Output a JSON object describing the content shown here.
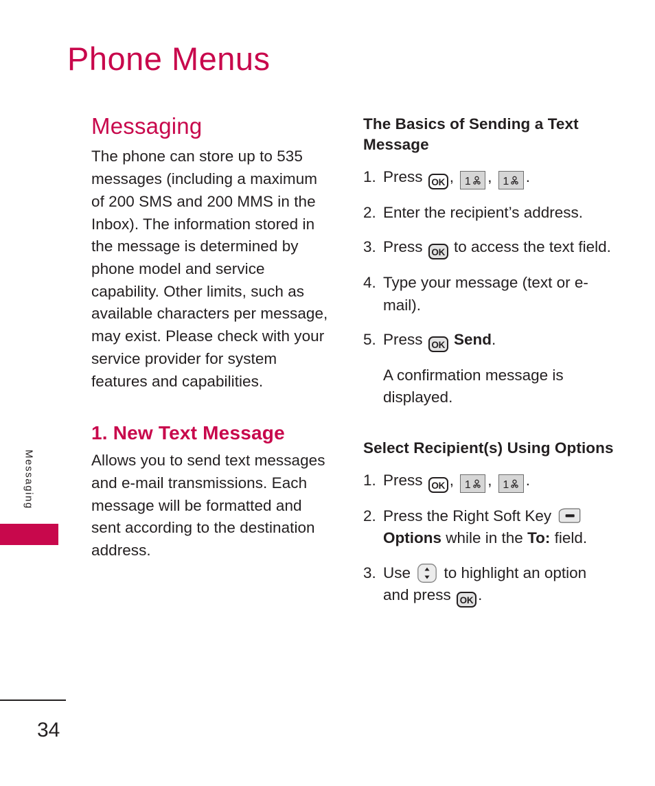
{
  "page": {
    "title": "Phone Menus",
    "number": "34",
    "side_tab_label": "Messaging",
    "accent_color": "#c8084c",
    "text_color": "#231f20"
  },
  "left_column": {
    "heading": "Messaging",
    "intro_paragraph": "The phone can store up to 535 messages (including a maximum of 200 SMS and 200 MMS in the Inbox). The information stored in the message is determined by phone model and service capability. Other limits, such as available characters per message, may exist. Please check with your service provider for system features and capabilities.",
    "subsection_heading": "1. New Text Message",
    "subsection_paragraph": "Allows you to send text messages and e-mail transmissions. Each message will be formatted and sent according to the destination address."
  },
  "right_column": {
    "basics": {
      "heading": "The Basics of Sending a Text Message",
      "steps": [
        {
          "num": "1.",
          "parts": [
            {
              "type": "text",
              "value": "Press "
            },
            {
              "type": "key",
              "icon": "ok-key-icon",
              "label": "OK",
              "style": "outline"
            },
            {
              "type": "text",
              "value": ", "
            },
            {
              "type": "key",
              "icon": "number-one-key-icon",
              "label": "1",
              "style": "numeric"
            },
            {
              "type": "text",
              "value": ", "
            },
            {
              "type": "key",
              "icon": "number-one-key-icon",
              "label": "1",
              "style": "numeric"
            },
            {
              "type": "text",
              "value": "."
            }
          ]
        },
        {
          "num": "2.",
          "parts": [
            {
              "type": "text",
              "value": "Enter the recipient’s address."
            }
          ]
        },
        {
          "num": "3.",
          "parts": [
            {
              "type": "text",
              "value": "Press "
            },
            {
              "type": "key",
              "icon": "ok-key-icon",
              "label": "OK",
              "style": "filled"
            },
            {
              "type": "text",
              "value": " to access the text field."
            }
          ]
        },
        {
          "num": "4.",
          "parts": [
            {
              "type": "text",
              "value": "Type your message (text or e-mail)."
            }
          ]
        },
        {
          "num": "5.",
          "parts": [
            {
              "type": "text",
              "value": "Press "
            },
            {
              "type": "key",
              "icon": "ok-key-icon",
              "label": "OK",
              "style": "filled"
            },
            {
              "type": "text",
              "value": " "
            },
            {
              "type": "bold",
              "value": "Send"
            },
            {
              "type": "text",
              "value": "."
            }
          ]
        }
      ],
      "note": "A confirmation message is displayed."
    },
    "select_recipients": {
      "heading": "Select Recipient(s) Using Options",
      "steps": [
        {
          "num": "1.",
          "parts": [
            {
              "type": "text",
              "value": "Press "
            },
            {
              "type": "key",
              "icon": "ok-key-icon",
              "label": "OK",
              "style": "outline"
            },
            {
              "type": "text",
              "value": ", "
            },
            {
              "type": "key",
              "icon": "number-one-key-icon",
              "label": "1",
              "style": "numeric"
            },
            {
              "type": "text",
              "value": ", "
            },
            {
              "type": "key",
              "icon": "number-one-key-icon",
              "label": "1",
              "style": "numeric"
            },
            {
              "type": "text",
              "value": "."
            }
          ]
        },
        {
          "num": "2.",
          "parts": [
            {
              "type": "text",
              "value": "Press the Right Soft Key "
            },
            {
              "type": "key",
              "icon": "right-soft-key-icon",
              "style": "soft"
            },
            {
              "type": "text",
              "value": " "
            },
            {
              "type": "bold",
              "value": "Options"
            },
            {
              "type": "text",
              "value": " while in the "
            },
            {
              "type": "bold",
              "value": "To:"
            },
            {
              "type": "text",
              "value": " field."
            }
          ]
        },
        {
          "num": "3.",
          "parts": [
            {
              "type": "text",
              "value": "Use "
            },
            {
              "type": "key",
              "icon": "navigation-up-down-key-icon",
              "style": "nav"
            },
            {
              "type": "text",
              "value": " to highlight an option and press "
            },
            {
              "type": "key",
              "icon": "ok-key-icon",
              "label": "OK",
              "style": "filled"
            },
            {
              "type": "text",
              "value": "."
            }
          ]
        }
      ]
    }
  }
}
